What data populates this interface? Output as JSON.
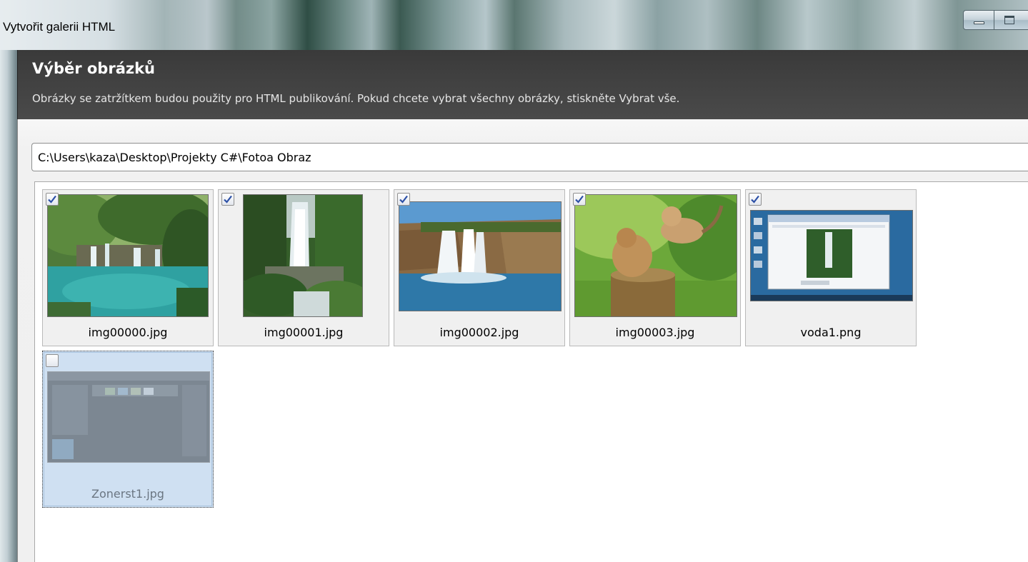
{
  "window": {
    "title": "Vytvořit galerii HTML"
  },
  "header": {
    "title": "Výběr obrázků",
    "description": "Obrázky se zatržítkem budou použity pro HTML publikování. Pokud chcete vybrat všechny obrázky, stiskněte Vybrat vše."
  },
  "path": {
    "value": "C:\\Users\\kaza\\Desktop\\Projekty C#\\Fotoa Obraz"
  },
  "gallery": {
    "items": [
      {
        "filename": "img00000.jpg",
        "checked": true,
        "content": "waterfall-lake"
      },
      {
        "filename": "img00001.jpg",
        "checked": true,
        "content": "waterfall-forest"
      },
      {
        "filename": "img00002.jpg",
        "checked": true,
        "content": "waterfall-cliff"
      },
      {
        "filename": "img00003.jpg",
        "checked": true,
        "content": "kittens-playing"
      },
      {
        "filename": "voda1.png",
        "checked": true,
        "content": "desktop-screenshot"
      },
      {
        "filename": "Zonerst1.jpg",
        "checked": false,
        "selected": true,
        "content": "app-screenshot"
      }
    ]
  },
  "colors": {
    "header_bg": "#3a3a3a",
    "selection_bg": "#cfe0f2",
    "checkmark": "#2b4fa6"
  }
}
